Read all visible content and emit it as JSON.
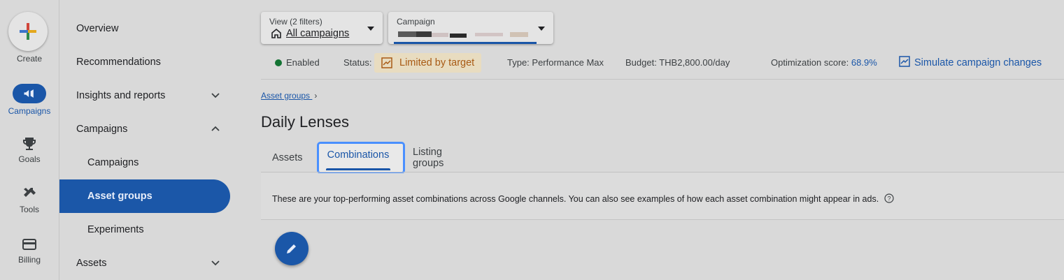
{
  "rail": {
    "create": "Create",
    "campaigns": "Campaigns",
    "goals": "Goals",
    "tools": "Tools",
    "billing": "Billing"
  },
  "nav": {
    "overview": "Overview",
    "recommendations": "Recommendations",
    "insights": "Insights and reports",
    "campaigns_group": "Campaigns",
    "campaigns": "Campaigns",
    "asset_groups": "Asset groups",
    "experiments": "Experiments",
    "assets": "Assets"
  },
  "filters": {
    "view_caption": "View (2 filters)",
    "view_value": "All campaigns",
    "campaign_caption": "Campaign"
  },
  "status": {
    "enabled": "Enabled",
    "status_label": "Status:",
    "status_value": "Limited by target",
    "type": "Type: Performance Max",
    "budget_label": "Budget:",
    "budget_value": "THB2,800.00/day",
    "opt_label": "Optimization score:",
    "opt_value": "68.9%",
    "simulate": "Simulate campaign changes"
  },
  "breadcrumb": "Asset groups",
  "page_title": "Daily Lenses",
  "tabs": [
    "Assets",
    "Combinations",
    "Listing groups"
  ],
  "panel_text": "These are your top-performing asset combinations across Google channels. You can also see examples of how each asset combination might appear in ads.",
  "colors": {
    "accent": "#1a56a8",
    "enabled": "#137333",
    "warning": "#a85a14"
  }
}
